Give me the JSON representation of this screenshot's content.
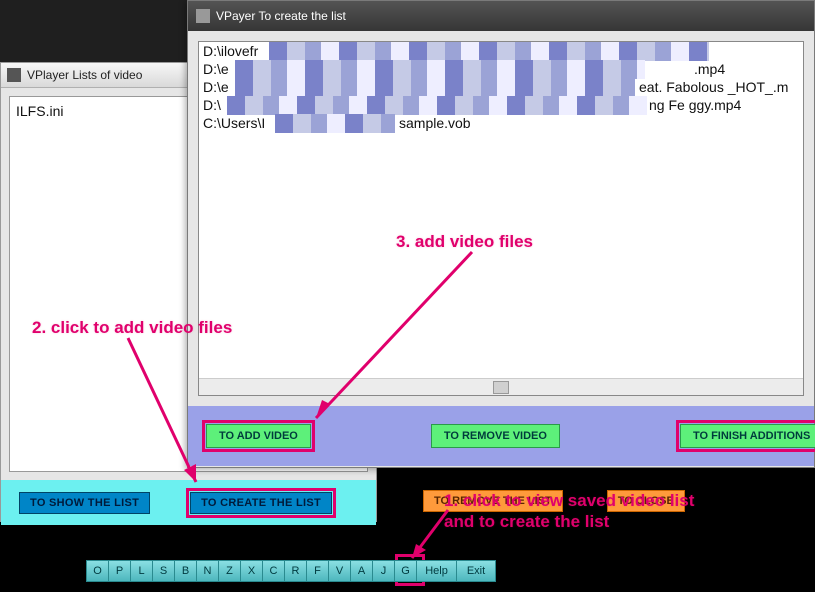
{
  "lists_window": {
    "title": "VPlayer Lists of video",
    "items": [
      "ILFS.ini"
    ],
    "buttons": {
      "show": "TO SHOW THE LIST",
      "create": "TO CREATE THE LIST"
    }
  },
  "create_window": {
    "title": "VPayer To create the list",
    "files": [
      {
        "prefix": "D:\\ilovefr",
        "suffix": ""
      },
      {
        "prefix": "D:\\e",
        "suffix": ".mp4"
      },
      {
        "prefix": "D:\\e",
        "suffix": "eat. Fabolous _HOT_.m"
      },
      {
        "prefix": "D:\\",
        "suffix": "ng Fe          ggy.mp4"
      },
      {
        "prefix": "C:\\Users\\I",
        "suffix": "sample.vob"
      }
    ],
    "buttons": {
      "add": "TO ADD VIDEO",
      "remove": "TO REMOVE VIDEO",
      "finish": "TO FINISH ADDITIONS"
    }
  },
  "orange_buttons": {
    "remove_list": "TO REMOVE THE LIST",
    "close": "TO CLOSE"
  },
  "annotations": {
    "step1": "1. click to view saved video list\nand to create the list",
    "step2": "2. click to add video files",
    "step3": "3. add video files"
  },
  "bottom_bar": [
    "O",
    "P",
    "L",
    "S",
    "B",
    "N",
    "Z",
    "X",
    "C",
    "R",
    "F",
    "V",
    "A",
    "J",
    "G",
    "Help",
    "Exit"
  ]
}
